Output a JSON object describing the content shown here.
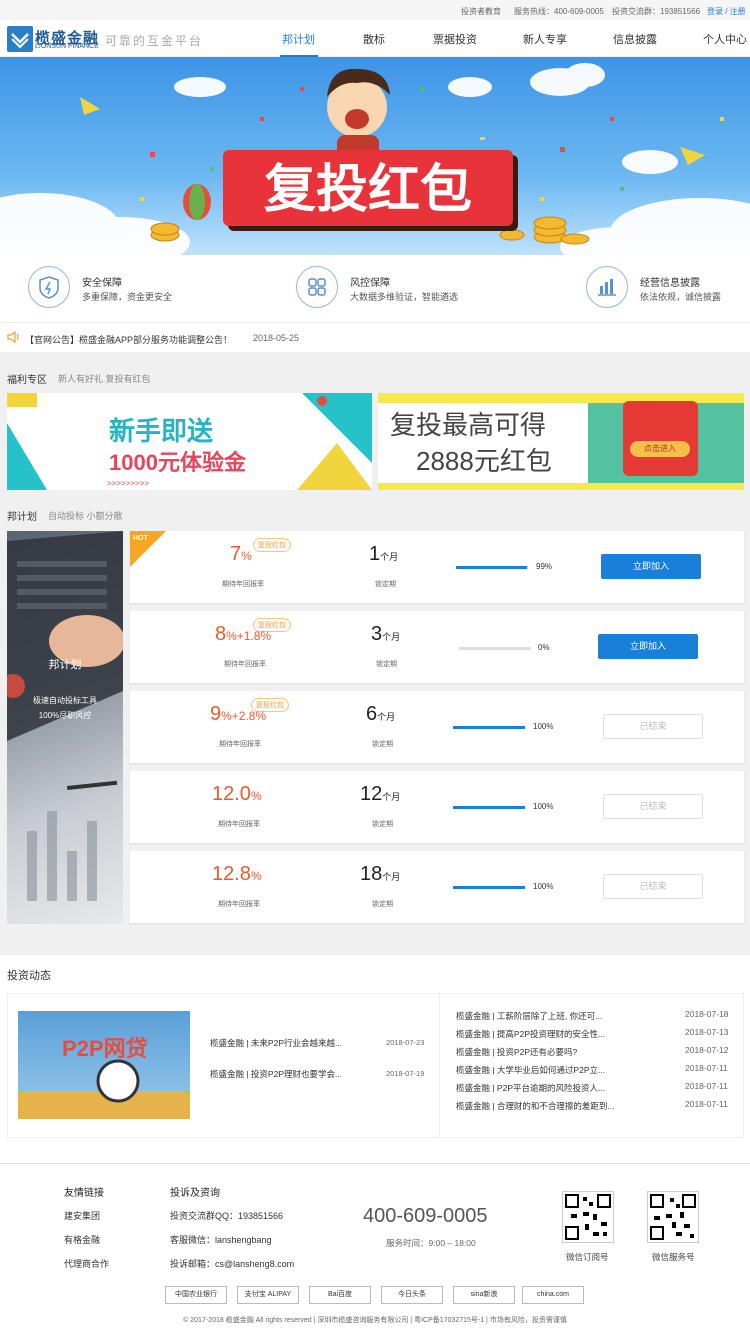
{
  "topbar": {
    "education": "投资者教育",
    "hotline": "服务热线：400-609-0005",
    "group": "投资交流群：193851566",
    "login": "登录 / 注册"
  },
  "logo": {
    "cn": "榄盛金融",
    "en": "LIONSUN FINANCE",
    "slogan": "可靠的互金平台"
  },
  "nav": [
    "邦计划",
    "散标",
    "票据投资",
    "新人专享",
    "信息披露",
    "个人中心"
  ],
  "banner": {
    "title": "复投红包"
  },
  "features": [
    {
      "icon": "shield-icon",
      "title": "安全保障",
      "desc": "多重保障，资金更安全"
    },
    {
      "icon": "grid-icon",
      "title": "风控保障",
      "desc": "大数据多维验证，智能遴选"
    },
    {
      "icon": "chart-icon",
      "title": "经营信息披露",
      "desc": "依法依规，诚信披露"
    }
  ],
  "notice": {
    "text": "【官网公告】榄盛金融APP部分服务功能调整公告！",
    "date": "2018-05-25"
  },
  "welfare": {
    "title": "福利专区",
    "sub": "新人有好礼 复投有红包",
    "promo1": {
      "line1": "新手即送",
      "line2": "1000元体验金"
    },
    "promo2": {
      "line1": "复投最高可得",
      "line2": "2888元红包",
      "button": "点击进入"
    }
  },
  "plan": {
    "title": "邦计划",
    "sub": "自动投标 小额分散",
    "side": {
      "title": "邦计划",
      "line1": "极速自动投标工具",
      "line2": "100%尽职风控"
    },
    "hot": "HOT",
    "rate_label": "期待年回报率",
    "term_label": "锁定期",
    "unit_month": "个月",
    "join": "立即加入",
    "done": "已结束",
    "tag": "复投红包",
    "rows": [
      {
        "rate": "7",
        "rate_extra": "%",
        "term": "1",
        "progress": 99,
        "pct": "99%",
        "status": "join",
        "tag": true
      },
      {
        "rate": "8",
        "rate_extra": "%+1.8%",
        "term": "3",
        "progress": 0,
        "pct": "0%",
        "status": "join",
        "tag": true
      },
      {
        "rate": "9",
        "rate_extra": "%+2.8%",
        "term": "6",
        "progress": 100,
        "pct": "100%",
        "status": "done",
        "tag": true
      },
      {
        "rate": "12.0",
        "rate_extra": "%",
        "term": "12",
        "progress": 100,
        "pct": "100%",
        "status": "done",
        "tag": false
      },
      {
        "rate": "12.8",
        "rate_extra": "%",
        "term": "18",
        "progress": 100,
        "pct": "100%",
        "status": "done",
        "tag": false
      }
    ]
  },
  "news": {
    "title": "投资动态",
    "image_text": "P2P网贷",
    "left": [
      {
        "t": "榄盛金融 | 未来P2P行业会越来越...",
        "d": "2018-07-23"
      },
      {
        "t": "榄盛金融 | 投资P2P理财也要学会...",
        "d": "2018-07-19"
      }
    ],
    "right": [
      {
        "t": "榄盛金融 | 工薪阶层除了上班, 你还可...",
        "d": "2018-07-18"
      },
      {
        "t": "榄盛金融 | 提高P2P投资理财的安全性...",
        "d": "2018-07-13"
      },
      {
        "t": "榄盛金融 | 投资P2P还有必要吗?",
        "d": "2018-07-12"
      },
      {
        "t": "榄盛金融 | 大学毕业后如何通过P2P立...",
        "d": "2018-07-11"
      },
      {
        "t": "榄盛金融 | P2P平台逾期的风险投资人...",
        "d": "2018-07-11"
      },
      {
        "t": "榄盛金融 | 合理财的和不合理擦的差距到...",
        "d": "2018-07-11"
      }
    ]
  },
  "footer": {
    "links_title": "友情链接",
    "links": [
      "建安集团",
      "有格金融",
      "代理商合作"
    ],
    "complaint_title": "投诉及资询",
    "complaint": [
      "投资交流群QQ：193851566",
      "客服微信：lanshengbang",
      "投诉邮箱：cs@lansheng8.com"
    ],
    "phone": "400-609-0005",
    "hours": "服务时间：9:00 – 18:00",
    "qr1": "微信订阅号",
    "qr2": "微信服务号",
    "badges": [
      "中国农业银行",
      "支付宝 ALIPAY",
      "Bai百度",
      "今日头条",
      "sina新浪",
      "china.com"
    ],
    "copyright": "© 2017-2018 榄盛金融 All rights reserved | 深圳市榄盛咨询服务有限公司 | 粤ICP备17032715号-1 | 市场有风险，投资需谨慎"
  },
  "colors": {
    "accent": "#1a7fd8",
    "rate": "#f05a28"
  }
}
